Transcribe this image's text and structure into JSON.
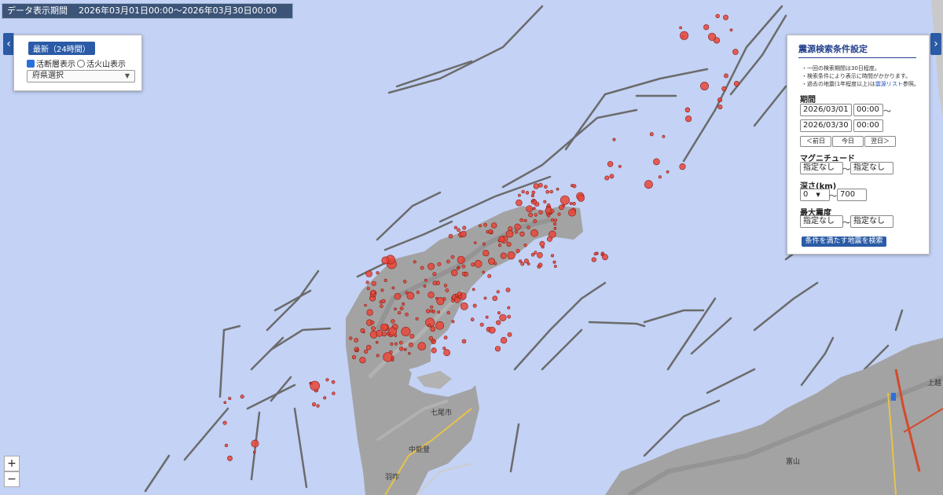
{
  "header": {
    "label": "データ表示期間",
    "range": "2026年03月01日00:00～2026年03月30日00:00"
  },
  "left_panel": {
    "latest_button": "最新（24時間）",
    "fault_toggle": {
      "label": "活断層表示",
      "checked": true
    },
    "volcano_toggle": {
      "label": "活火山表示",
      "checked": false
    },
    "prefecture_select": "府県選択"
  },
  "right_panel": {
    "title": "震源検索条件設定",
    "notes": [
      "・一回の検索期間は30日程度。",
      "・検索条件により表示に時間がかかります。",
      "・過去の地震(1年程度以上)は",
      "震源リスト",
      "参照。"
    ],
    "period_label": "期間",
    "start_date": "2026/03/01",
    "start_time": "00:00",
    "end_date": "2026/03/30",
    "end_time": "00:00",
    "tilde": "～",
    "prev_day": "＜前日",
    "today": "今日",
    "next_day": "翌日＞",
    "magnitude_label": "マグニチュード",
    "mag_min": "指定なし",
    "mag_max": "指定なし",
    "depth_label": "深さ(km)",
    "depth_min": "0",
    "depth_max": "700",
    "intensity_label": "最大震度",
    "int_min": "指定なし",
    "int_max": "指定なし",
    "search_button": "条件を満たす地震を検索"
  },
  "map_labels": [
    "七尾市",
    "中能登",
    "羽咋",
    "上越",
    "富山"
  ],
  "zoom": {
    "in": "+",
    "out": "−"
  },
  "colors": {
    "sea": "#c3d2f5",
    "land": "#a0a0a0",
    "quake": "#e8463a",
    "fault": "#555555",
    "panel_accent": "#2b5ba6"
  }
}
